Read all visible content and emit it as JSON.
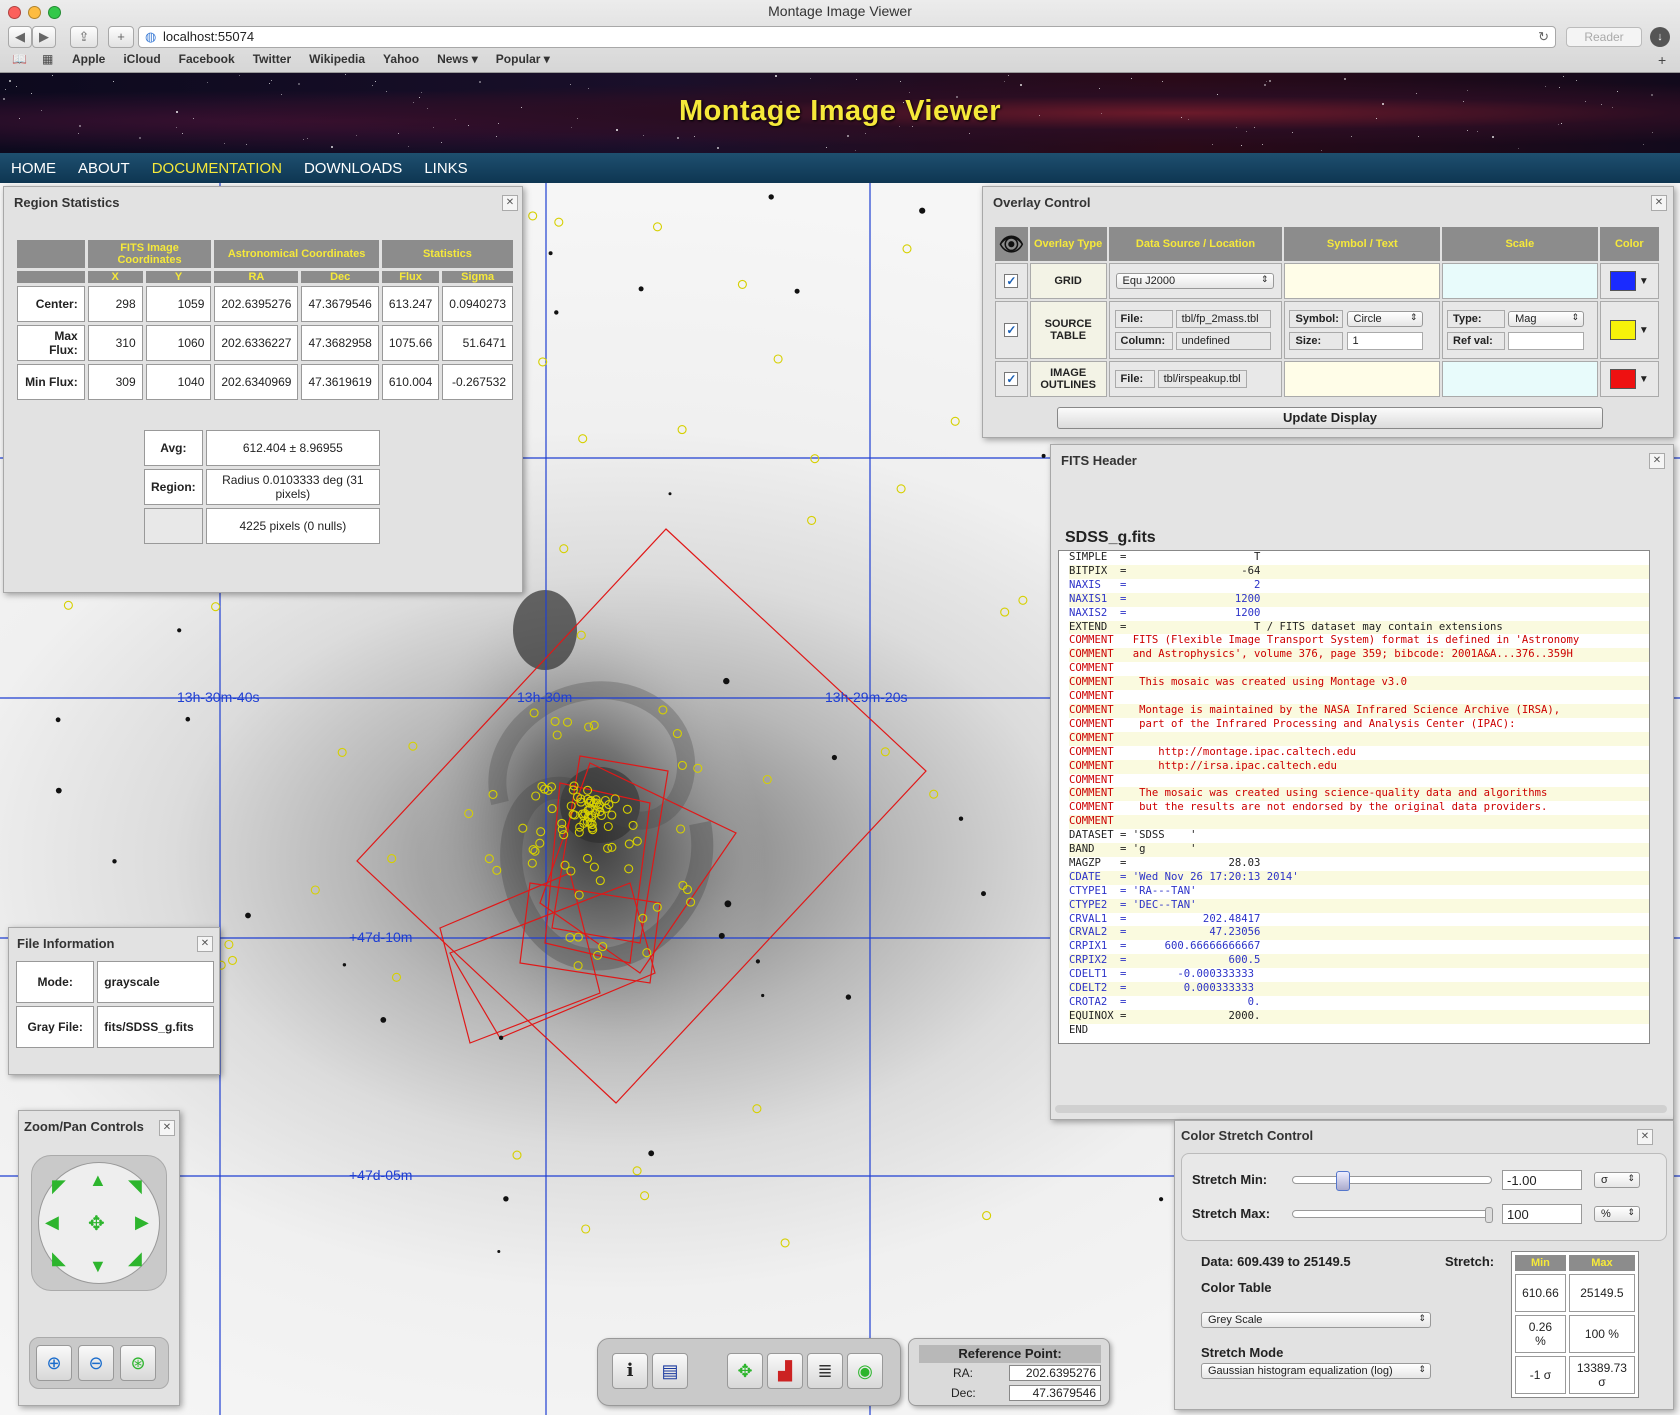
{
  "browser": {
    "window_title": "Montage Image Viewer",
    "url": "localhost:55074",
    "reader_label": "Reader",
    "bookmarks": [
      "Apple",
      "iCloud",
      "Facebook",
      "Twitter",
      "Wikipedia",
      "Yahoo",
      "News ▾",
      "Popular ▾"
    ]
  },
  "site": {
    "title": "Montage Image Viewer",
    "nav": [
      "HOME",
      "ABOUT",
      "DOCUMENTATION",
      "DOWNLOADS",
      "LINKS"
    ],
    "active_nav": "DOCUMENTATION"
  },
  "grid_labels": {
    "ra_left": "13h-30m-40s",
    "ra_center": "13h-30m",
    "ra_right": "13h-29m-20s",
    "dec_upper": "+47d-10m",
    "dec_lower": "+47d-05m"
  },
  "region_stats": {
    "title": "Region Statistics",
    "group_headers": [
      "FITS Image Coordinates",
      "Astronomical Coordinates",
      "Statistics"
    ],
    "sub_headers": [
      "X",
      "Y",
      "RA",
      "Dec",
      "Flux",
      "Sigma"
    ],
    "rows": [
      {
        "label": "Center:",
        "cells": [
          "298",
          "1059",
          "202.6395276",
          "47.3679546",
          "613.247",
          "0.0940273"
        ]
      },
      {
        "label": "Max Flux:",
        "cells": [
          "310",
          "1060",
          "202.6336227",
          "47.3682958",
          "1075.66",
          "51.6471"
        ]
      },
      {
        "label": "Min Flux:",
        "cells": [
          "309",
          "1040",
          "202.6340969",
          "47.3619619",
          "610.004",
          "-0.267532"
        ]
      }
    ],
    "avg_label": "Avg:",
    "avg_value": "612.404 ± 8.96955",
    "region_label": "Region:",
    "region_value": "Radius 0.0103333 deg  (31 pixels)",
    "pixels_value": "4225 pixels (0 nulls)"
  },
  "overlay_control": {
    "title": "Overlay Control",
    "headers": [
      "Overlay Type",
      "Data Source / Location",
      "Symbol / Text",
      "Scale",
      "Color"
    ],
    "grid": {
      "type": "GRID",
      "source": "Equ J2000",
      "color": "#1a2bff"
    },
    "source_table": {
      "type_line1": "SOURCE",
      "type_line2": "TABLE",
      "file_label": "File:",
      "file_value": "tbl/fp_2mass.tbl",
      "column_label": "Column:",
      "column_value": "undefined",
      "symbol_label": "Symbol:",
      "symbol_value": "Circle",
      "size_label": "Size:",
      "size_value": "1",
      "scale_type_label": "Type:",
      "scale_type_value": "Mag",
      "ref_label": "Ref val:",
      "ref_value": "",
      "color": "#f7f20a"
    },
    "image_outlines": {
      "type_line1": "IMAGE",
      "type_line2": "OUTLINES",
      "file_label": "File:",
      "file_value": "tbl/irspeakup.tbl",
      "color": "#ee1111"
    },
    "update_button": "Update Display"
  },
  "fits_header": {
    "title": "FITS Header",
    "filename": "SDSS_g.fits",
    "lines": [
      {
        "t": "SIMPLE  =                    T",
        "c": "pl"
      },
      {
        "t": "BITPIX  =                  -64",
        "c": "pl"
      },
      {
        "t": "NAXIS   =                    2",
        "c": "kw"
      },
      {
        "t": "NAXIS1  =                 1200",
        "c": "kw"
      },
      {
        "t": "NAXIS2  =                 1200",
        "c": "kw"
      },
      {
        "t": "EXTEND  =                    T / FITS dataset may contain extensions",
        "c": "pl"
      },
      {
        "t": "COMMENT   FITS (Flexible Image Transport System) format is defined in 'Astronomy",
        "c": "cm"
      },
      {
        "t": "COMMENT   and Astrophysics', volume 376, page 359; bibcode: 2001A&A...376..359H",
        "c": "cm"
      },
      {
        "t": "COMMENT",
        "c": "cm"
      },
      {
        "t": "COMMENT    This mosaic was created using Montage v3.0",
        "c": "cm"
      },
      {
        "t": "COMMENT",
        "c": "cm"
      },
      {
        "t": "COMMENT    Montage is maintained by the NASA Infrared Science Archive (IRSA),",
        "c": "cm"
      },
      {
        "t": "COMMENT    part of the Infrared Processing and Analysis Center (IPAC):",
        "c": "cm"
      },
      {
        "t": "COMMENT",
        "c": "cm"
      },
      {
        "t": "COMMENT       http://montage.ipac.caltech.edu",
        "c": "cm"
      },
      {
        "t": "COMMENT       http://irsa.ipac.caltech.edu",
        "c": "cm"
      },
      {
        "t": "COMMENT",
        "c": "cm"
      },
      {
        "t": "COMMENT    The mosaic was created using science-quality data and algorithms",
        "c": "cm"
      },
      {
        "t": "COMMENT    but the results are not endorsed by the original data providers.",
        "c": "cm"
      },
      {
        "t": "COMMENT",
        "c": "cm"
      },
      {
        "t": "DATASET = 'SDSS    '",
        "c": "pl"
      },
      {
        "t": "BAND    = 'g       '",
        "c": "pl"
      },
      {
        "t": "MAGZP   =                28.03",
        "c": "pl"
      },
      {
        "t": "CDATE   = 'Wed Nov 26 17:20:13 2014'",
        "c": "kw"
      },
      {
        "t": "CTYPE1  = 'RA---TAN'",
        "c": "kw"
      },
      {
        "t": "CTYPE2  = 'DEC--TAN'",
        "c": "kw"
      },
      {
        "t": "CRVAL1  =            202.48417",
        "c": "kw"
      },
      {
        "t": "CRVAL2  =             47.23056",
        "c": "kw"
      },
      {
        "t": "CRPIX1  =      600.66666666667",
        "c": "kw"
      },
      {
        "t": "CRPIX2  =                600.5",
        "c": "kw"
      },
      {
        "t": "CDELT1  =        -0.000333333",
        "c": "kw"
      },
      {
        "t": "CDELT2  =         0.000333333",
        "c": "kw"
      },
      {
        "t": "CROTA2  =                   0.",
        "c": "kw"
      },
      {
        "t": "EQUINOX =                2000.",
        "c": "pl"
      },
      {
        "t": "END",
        "c": "pl"
      }
    ]
  },
  "file_info": {
    "title": "File Information",
    "mode_label": "Mode:",
    "mode_value": "grayscale",
    "gray_label": "Gray File:",
    "gray_value": "fits/SDSS_g.fits"
  },
  "zoom_pan": {
    "title": "Zoom/Pan Controls"
  },
  "color_stretch": {
    "title": "Color Stretch Control",
    "min_label": "Stretch Min:",
    "min_value": "-1.00",
    "min_unit": "σ",
    "min_slider": 0.25,
    "max_label": "Stretch Max:",
    "max_value": "100",
    "max_unit": "%",
    "max_slider": 1.0,
    "data_range": "Data: 609.439 to 25149.5",
    "stretch_label": "Stretch:",
    "color_table_label": "Color Table",
    "color_table_value": "Grey Scale",
    "stretch_mode_label": "Stretch Mode",
    "stretch_mode_value": "Gaussian histogram equalization (log)",
    "table_headers": [
      "Min",
      "Max"
    ],
    "table_rows": [
      [
        "610.66",
        "25149.5"
      ],
      [
        "0.26 %",
        "100 %"
      ],
      [
        "-1 σ",
        "13389.73 σ"
      ]
    ]
  },
  "reference_point": {
    "title": "Reference Point:",
    "ra_label": "RA:",
    "ra_value": "202.6395276",
    "dec_label": "Dec:",
    "dec_value": "47.3679546"
  },
  "colors": {
    "grid": "#1f3fd2",
    "outline": "#e01818",
    "source": "#e8e000",
    "accent": "#f6e93a",
    "nav": "#0e3652"
  }
}
